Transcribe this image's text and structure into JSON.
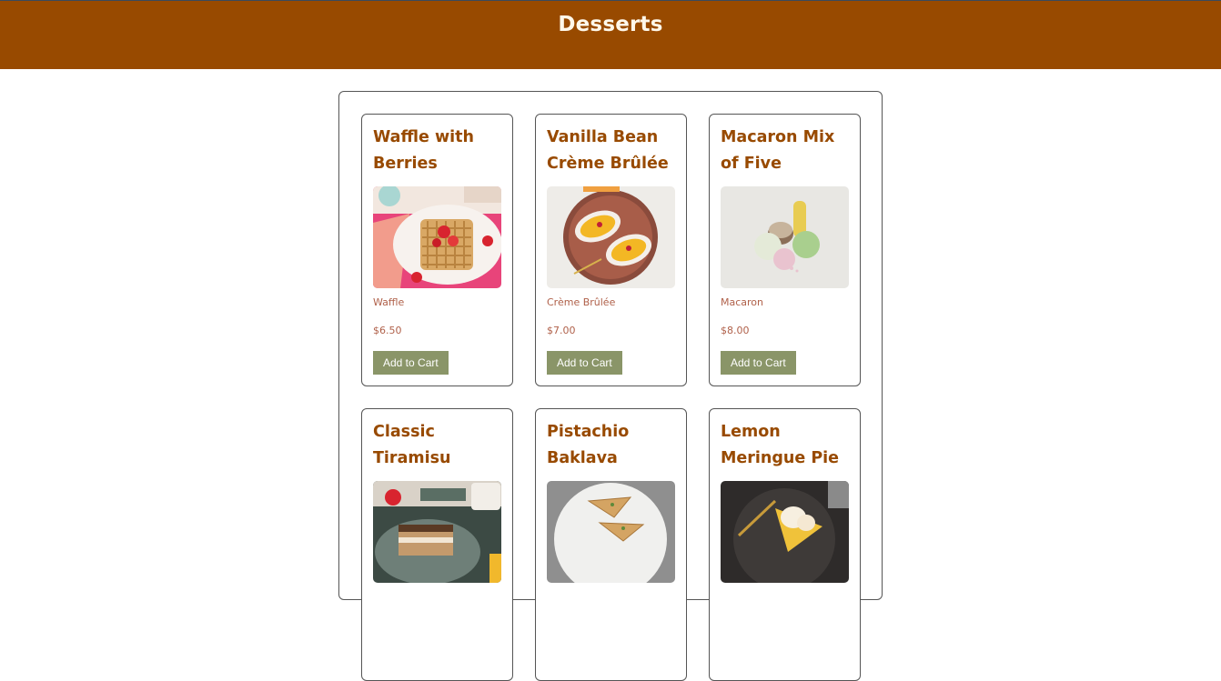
{
  "header": {
    "title": "Desserts"
  },
  "products": [
    {
      "name": "Waffle with Berries",
      "category": "Waffle",
      "price": "$6.50",
      "button": "Add to Cart",
      "image": "waffle-image"
    },
    {
      "name": "Vanilla Bean Crème Brûlée",
      "category": "Crème Brûlée",
      "price": "$7.00",
      "button": "Add to Cart",
      "image": "creme-brulee-image"
    },
    {
      "name": "Macaron Mix of Five",
      "category": "Macaron",
      "price": "$8.00",
      "button": "Add to Cart",
      "image": "macaron-image"
    },
    {
      "name": "Classic Tiramisu",
      "category": "",
      "price": "",
      "button": "",
      "image": "tiramisu-image"
    },
    {
      "name": "Pistachio Baklava",
      "category": "",
      "price": "",
      "button": "",
      "image": "baklava-image"
    },
    {
      "name": "Lemon Meringue Pie",
      "category": "",
      "price": "",
      "button": "",
      "image": "lemon-pie-image"
    }
  ],
  "colors": {
    "header_bg": "#984a00",
    "title_text": "#984a00",
    "meta_text": "#b0614a",
    "button_bg": "#8a9568"
  }
}
